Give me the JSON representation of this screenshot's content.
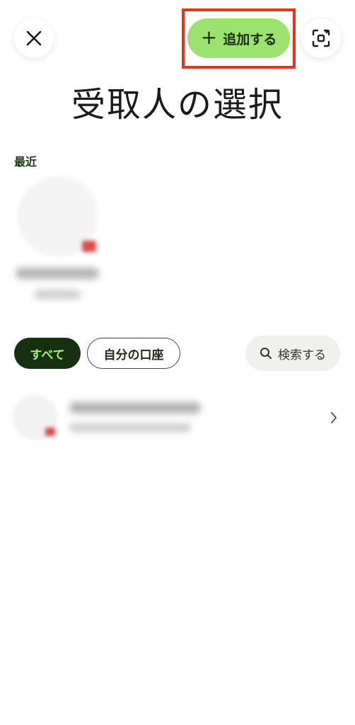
{
  "header": {
    "add_label": "追加する",
    "add_icon": "plus-icon",
    "close_icon": "close-icon",
    "scan_icon": "scan-icon",
    "highlight_color": "#e8321c",
    "add_button_color": "#9be36e"
  },
  "title": "受取人の選択",
  "recent": {
    "label": "最近"
  },
  "filters": {
    "all_label": "すべて",
    "own_account_label": "自分の口座",
    "search_label": "検索する",
    "search_icon": "search-icon"
  },
  "list": {
    "chevron_icon": "chevron-right-icon"
  },
  "colors": {
    "active_chip_bg": "#17300f",
    "active_chip_text": "#a6f07a"
  }
}
